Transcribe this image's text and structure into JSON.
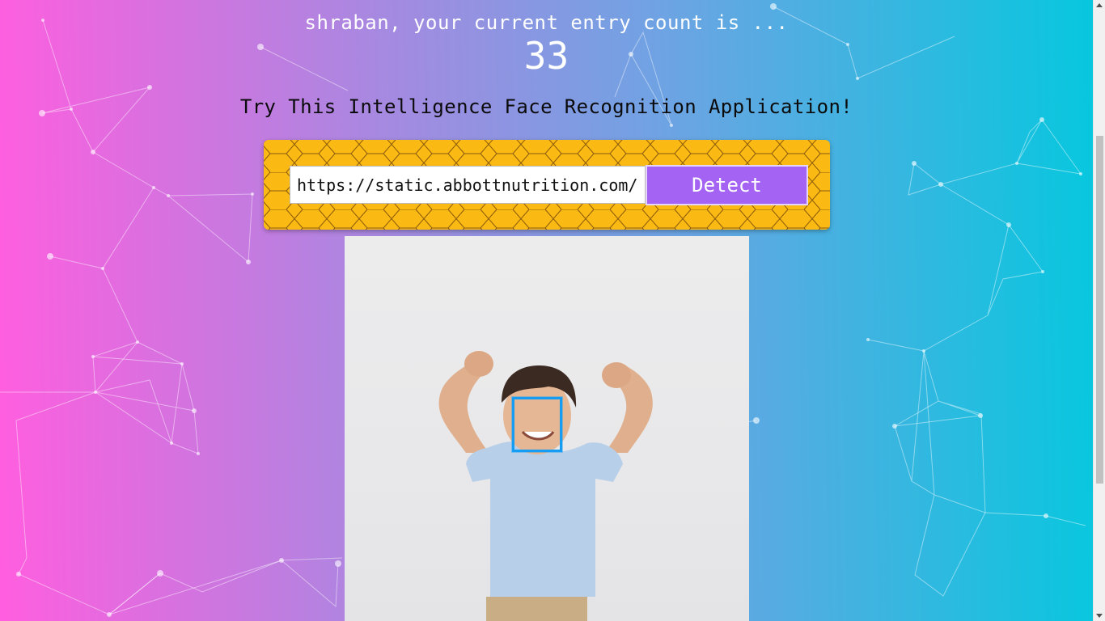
{
  "greeting": {
    "text": "shraban, your current entry count is ...",
    "count": "33"
  },
  "tagline": "Try This Intelligence Face Recognition Application!",
  "form": {
    "url_value": "https://static.abbottnutrition.com/c",
    "detect_label": "Detect"
  },
  "colors": {
    "gradient_start": "#ff5edf",
    "gradient_end": "#04c8de",
    "panel": "#fbb913",
    "button": "#a463f2",
    "face_box": "#149df2"
  },
  "image": {
    "subject": "smiling boy with raised arms in light blue t-shirt",
    "detected_faces": 1
  }
}
